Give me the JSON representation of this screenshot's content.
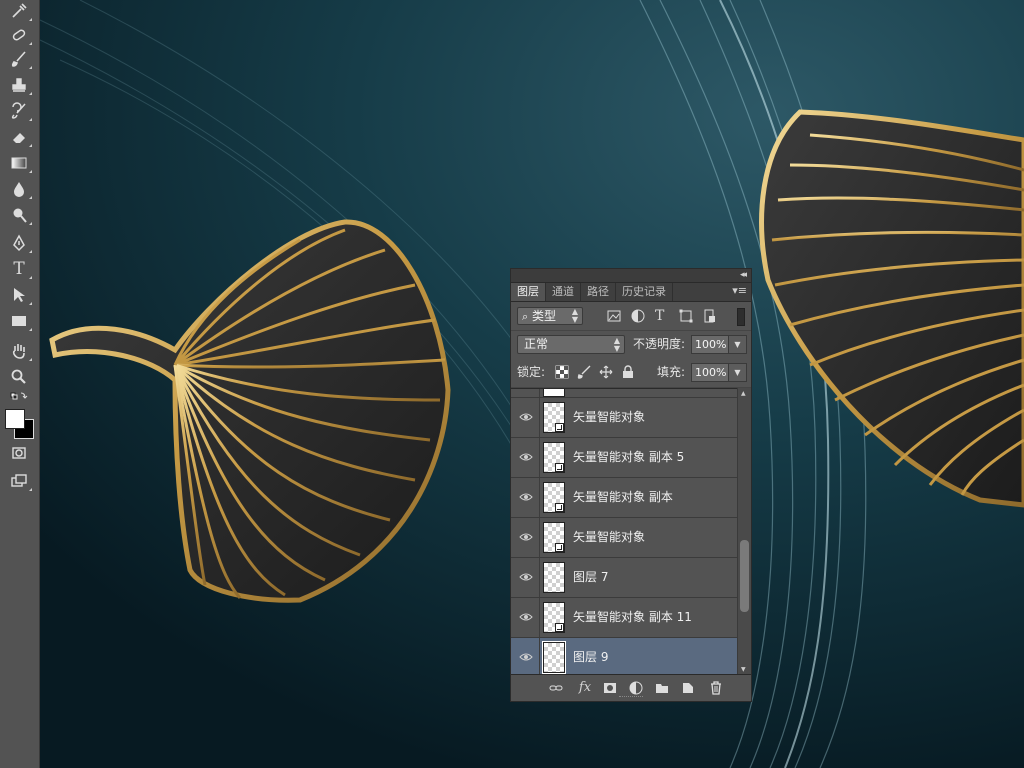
{
  "tools": [
    "eyedropper-icon",
    "healing-brush-icon",
    "brush-icon",
    "clone-stamp-icon",
    "history-brush-icon",
    "eraser-icon",
    "gradient-icon",
    "blur-drop-icon",
    "dodge-icon",
    "pen-icon",
    "type-icon",
    "path-selection-icon",
    "rectangle-icon",
    "hand-icon",
    "zoom-icon",
    "swap-colors-icon",
    "color-swatches-icon",
    "quick-mask-icon",
    "screen-mode-icon"
  ],
  "tool_glyphs": {
    "type": "T"
  },
  "panel": {
    "collapse_glyph": "◂◂",
    "menu_glyph": "▾≡",
    "tabs": [
      "图层",
      "通道",
      "路径",
      "历史记录"
    ],
    "active_tab": "图层",
    "filter": {
      "label": "类型",
      "search_glyph": "⌕"
    },
    "blend_mode": "正常",
    "opacity_label": "不透明度:",
    "opacity_value": "100%",
    "lock_label": "锁定:",
    "fill_label": "填充:",
    "fill_value": "100%",
    "layers": [
      {
        "name": "矢量智能对象",
        "kind": "smart",
        "selected": false
      },
      {
        "name": "矢量智能对象 副本 5",
        "kind": "smart",
        "selected": false
      },
      {
        "name": "矢量智能对象 副本",
        "kind": "smart",
        "selected": false
      },
      {
        "name": "矢量智能对象",
        "kind": "smart",
        "selected": false
      },
      {
        "name": "图层 7",
        "kind": "pixel",
        "selected": false
      },
      {
        "name": "矢量智能对象 副本 11",
        "kind": "smart",
        "selected": false
      },
      {
        "name": "图层 9",
        "kind": "pixel",
        "selected": true
      }
    ],
    "footer_icons": [
      "link-icon",
      "fx-icon",
      "mask-icon",
      "adjustment-icon",
      "folder-icon",
      "new-layer-icon",
      "trash-icon"
    ],
    "fx_label": "fx"
  },
  "colors": {
    "panel_bg": "#535353",
    "selected_layer": "#5a6a80",
    "leaf_gold": "#d8b25c",
    "canvas_bg": "#0f2a33"
  }
}
